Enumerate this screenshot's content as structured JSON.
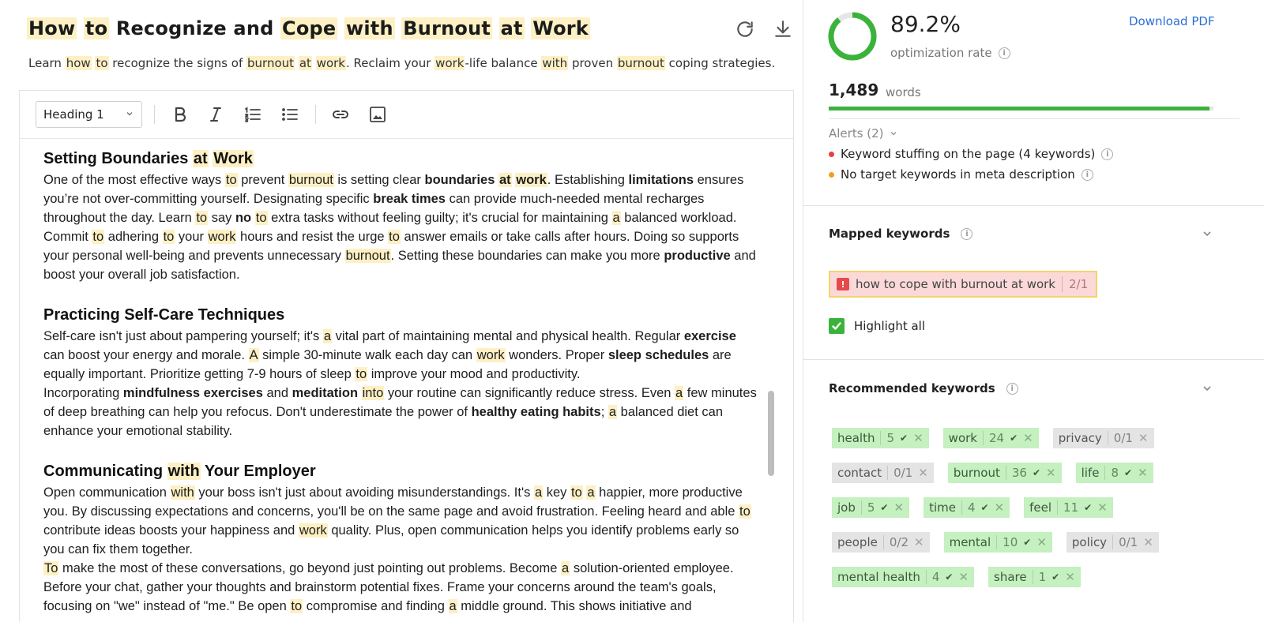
{
  "article": {
    "title_parts": [
      {
        "t": "How",
        "h": true
      },
      {
        "t": " ",
        "h": false
      },
      {
        "t": "to",
        "h": true
      },
      {
        "t": " Recognize and ",
        "h": false
      },
      {
        "t": "Cope",
        "h": true
      },
      {
        "t": " ",
        "h": false
      },
      {
        "t": "with",
        "h": true
      },
      {
        "t": " ",
        "h": false
      },
      {
        "t": "Burnout",
        "h": true
      },
      {
        "t": " ",
        "h": false
      },
      {
        "t": "at",
        "h": true
      },
      {
        "t": " ",
        "h": false
      },
      {
        "t": "Work",
        "h": true
      }
    ],
    "subtitle_parts": [
      {
        "t": "Learn ",
        "h": false
      },
      {
        "t": "how",
        "h": true
      },
      {
        "t": " ",
        "h": false
      },
      {
        "t": "to",
        "h": true
      },
      {
        "t": " recognize the signs of ",
        "h": false
      },
      {
        "t": "burnout",
        "h": true
      },
      {
        "t": " ",
        "h": false
      },
      {
        "t": "at",
        "h": true
      },
      {
        "t": " ",
        "h": false
      },
      {
        "t": "work",
        "h": true
      },
      {
        "t": ". Reclaim your ",
        "h": false
      },
      {
        "t": "work",
        "h": true
      },
      {
        "t": "-life balance ",
        "h": false
      },
      {
        "t": "with",
        "h": true
      },
      {
        "t": " proven ",
        "h": false
      },
      {
        "t": "burnout",
        "h": true
      },
      {
        "t": " coping strategies.",
        "h": false
      }
    ]
  },
  "toolbar": {
    "heading_select": "Heading 1"
  },
  "sections": [
    {
      "heading": [
        {
          "t": "Setting Boundaries ",
          "h": false
        },
        {
          "t": "at",
          "h": true
        },
        {
          "t": " ",
          "h": false
        },
        {
          "t": "Work",
          "h": true
        }
      ],
      "paragraphs": [
        [
          {
            "t": "One of the most effective ways "
          },
          {
            "t": "to",
            "h": true
          },
          {
            "t": " prevent "
          },
          {
            "t": "burnout",
            "h": true
          },
          {
            "t": " is setting clear "
          },
          {
            "t": "boundaries ",
            "b": true
          },
          {
            "t": "at",
            "b": true,
            "h": true
          },
          {
            "t": " ",
            "b": true
          },
          {
            "t": "work",
            "b": true,
            "h": true
          },
          {
            "t": ". Establishing "
          },
          {
            "t": "limitations",
            "b": true
          },
          {
            "t": " ensures you’re not over-committing yourself. Designating specific "
          },
          {
            "t": "break times",
            "b": true
          },
          {
            "t": " can provide much-needed mental recharges throughout the day. Learn "
          },
          {
            "t": "to",
            "h": true
          },
          {
            "t": " say "
          },
          {
            "t": "no",
            "b": true
          },
          {
            "t": " "
          },
          {
            "t": "to",
            "h": true
          },
          {
            "t": " extra tasks without feeling guilty; it's crucial for maintaining "
          },
          {
            "t": "a",
            "h": true
          },
          {
            "t": " balanced workload. Commit "
          },
          {
            "t": "to",
            "h": true
          },
          {
            "t": " adhering "
          },
          {
            "t": "to",
            "h": true
          },
          {
            "t": " your "
          },
          {
            "t": "work",
            "h": true
          },
          {
            "t": " hours and resist the urge "
          },
          {
            "t": "to",
            "h": true
          },
          {
            "t": " answer emails or take calls after hours. Doing so supports your personal well-being and prevents unnecessary "
          },
          {
            "t": "burnout",
            "h": true
          },
          {
            "t": ". Setting these boundaries can make you more "
          },
          {
            "t": "productive",
            "b": true
          },
          {
            "t": " and boost your overall job satisfaction."
          }
        ]
      ]
    },
    {
      "heading": [
        {
          "t": "Practicing Self-Care Techniques",
          "h": false
        }
      ],
      "paragraphs": [
        [
          {
            "t": "Self-care isn't just about pampering yourself; it's "
          },
          {
            "t": "a",
            "h": true
          },
          {
            "t": " vital part of maintaining mental and physical health. Regular "
          },
          {
            "t": "exercise",
            "b": true
          },
          {
            "t": " can boost your energy and morale. "
          },
          {
            "t": "A",
            "h": true
          },
          {
            "t": " simple 30-minute walk each day can "
          },
          {
            "t": "work",
            "h": true
          },
          {
            "t": " wonders. Proper "
          },
          {
            "t": "sleep schedules",
            "b": true
          },
          {
            "t": " are equally important. Prioritize getting 7-9 hours of sleep "
          },
          {
            "t": "to",
            "h": true
          },
          {
            "t": " improve your mood and productivity."
          }
        ],
        [
          {
            "t": "Incorporating "
          },
          {
            "t": "mindfulness exercises",
            "b": true
          },
          {
            "t": " and "
          },
          {
            "t": "meditation",
            "b": true
          },
          {
            "t": " "
          },
          {
            "t": "into",
            "h": true
          },
          {
            "t": " your routine can significantly reduce stress. Even "
          },
          {
            "t": "a",
            "h": true
          },
          {
            "t": " few minutes of deep breathing can help you refocus. Don't underestimate the power of "
          },
          {
            "t": "healthy eating habits",
            "b": true
          },
          {
            "t": "; "
          },
          {
            "t": "a",
            "h": true
          },
          {
            "t": " balanced diet can enhance your emotional stability."
          }
        ]
      ]
    },
    {
      "heading": [
        {
          "t": "Communicating ",
          "h": false
        },
        {
          "t": "with",
          "h": true
        },
        {
          "t": " Your Employer",
          "h": false
        }
      ],
      "paragraphs": [
        [
          {
            "t": "Open communication "
          },
          {
            "t": "with",
            "h": true
          },
          {
            "t": " your boss isn't just about avoiding misunderstandings. It's "
          },
          {
            "t": "a",
            "h": true
          },
          {
            "t": " key "
          },
          {
            "t": "to",
            "h": true
          },
          {
            "t": " "
          },
          {
            "t": "a",
            "h": true
          },
          {
            "t": " happier, more productive you. By discussing expectations and concerns, you'll be on the same page and avoid frustration. Feeling heard and able "
          },
          {
            "t": "to",
            "h": true
          },
          {
            "t": " contribute ideas boosts your happiness and "
          },
          {
            "t": "work",
            "h": true
          },
          {
            "t": " quality. Plus, open communication helps you identify problems early so you can fix them together."
          }
        ],
        [
          {
            "t": "To",
            "h": true
          },
          {
            "t": " make the most of these conversations, go beyond just pointing out problems. Become "
          },
          {
            "t": "a",
            "h": true
          },
          {
            "t": " solution-oriented employee. Before your chat, gather your thoughts and brainstorm potential fixes. Frame your concerns around the team's goals, focusing on \"we\" instead of \"me.\" Be open "
          },
          {
            "t": "to",
            "h": true
          },
          {
            "t": " compromise and finding "
          },
          {
            "t": "a",
            "h": true
          },
          {
            "t": " middle ground. This shows initiative and"
          }
        ]
      ]
    }
  ],
  "sidebar": {
    "optimization_value": "89.2%",
    "optimization_fraction": 0.892,
    "optimization_label": "optimization rate",
    "download_pdf": "Download PDF",
    "word_count": "1,489",
    "word_label": "words",
    "word_progress": 0.99,
    "alerts_label": "Alerts (2)",
    "alerts": [
      {
        "text": "Keyword stuffing on the page (4 keywords)",
        "color": "#e84040"
      },
      {
        "text": "No target keywords in meta description",
        "color": "#f0a020"
      }
    ],
    "mapped_title": "Mapped keywords",
    "mapped_keyword": "how to cope with burnout at work",
    "mapped_count": "2/1",
    "highlight_all": "Highlight all",
    "recommended_title": "Recommended keywords",
    "keyword_rows": [
      [
        {
          "k": "health",
          "c": "5",
          "ok": true
        },
        {
          "k": "work",
          "c": "24",
          "ok": true
        },
        {
          "k": "privacy",
          "c": "0/1",
          "ok": false
        }
      ],
      [
        {
          "k": "contact",
          "c": "0/1",
          "ok": false
        },
        {
          "k": "burnout",
          "c": "36",
          "ok": true
        },
        {
          "k": "life",
          "c": "8",
          "ok": true
        }
      ],
      [
        {
          "k": "job",
          "c": "5",
          "ok": true
        },
        {
          "k": "time",
          "c": "4",
          "ok": true
        },
        {
          "k": "feel",
          "c": "11",
          "ok": true
        }
      ],
      [
        {
          "k": "people",
          "c": "0/2",
          "ok": false
        },
        {
          "k": "mental",
          "c": "10",
          "ok": true
        },
        {
          "k": "policy",
          "c": "0/1",
          "ok": false
        }
      ],
      [
        {
          "k": "mental health",
          "c": "4",
          "ok": true
        },
        {
          "k": "share",
          "c": "1",
          "ok": true
        }
      ]
    ]
  },
  "colors": {
    "accent_green": "#3bb33b",
    "highlight": "#fdf0c4",
    "link_blue": "#2a6fd6"
  }
}
